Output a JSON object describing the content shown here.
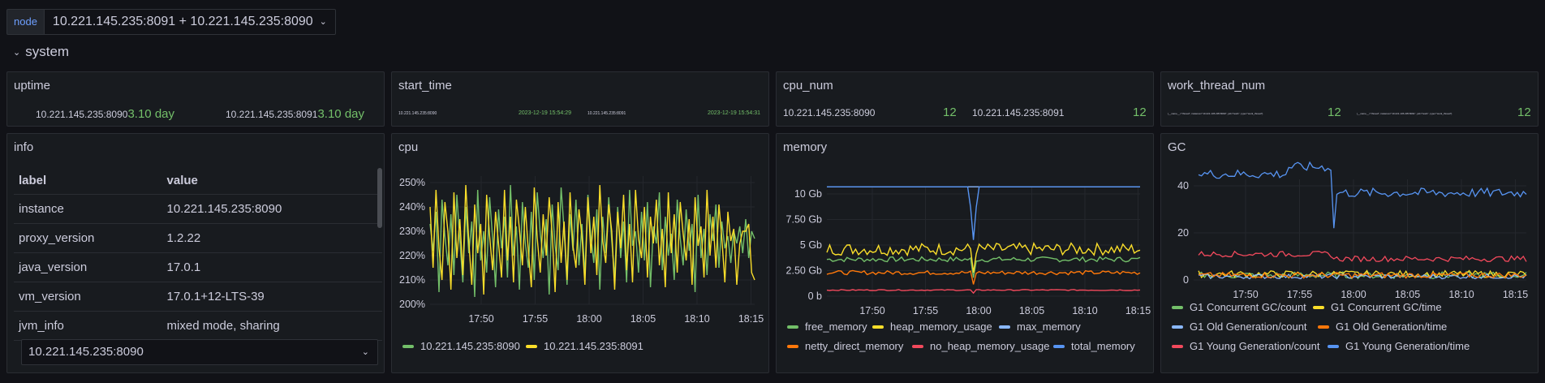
{
  "variable": {
    "label": "node",
    "value": "10.221.145.235:8091 + 10.221.145.235:8090"
  },
  "row": {
    "title": "system"
  },
  "colors": {
    "green": "#73bf69",
    "yellow": "#fade2a",
    "blue": "#5794f2",
    "orange": "#ff780a",
    "red": "#f2495c"
  },
  "uptime": {
    "title": "uptime",
    "items": [
      {
        "label": "10.221.145.235:8090",
        "value": "3.10 day"
      },
      {
        "label": "10.221.145.235:8091",
        "value": "3.10 day"
      }
    ]
  },
  "start_time": {
    "title": "start_time",
    "items": [
      {
        "label": "10.221.145.235:8090",
        "value": "2023-12-19 15:54:29"
      },
      {
        "label": "10.221.145.235:8091",
        "value": "2023-12-19 15:54:31"
      }
    ]
  },
  "cpu_num": {
    "title": "cpu_num",
    "items": [
      {
        "label": "10.221.145.235:8090",
        "value": "12"
      },
      {
        "label": "10.221.145.235:8091",
        "value": "12"
      }
    ]
  },
  "work_thread_num": {
    "title": "work_thread_num",
    "items": [
      {
        "label": "{__name__=\"thread\", instance=\"10.221.145.235:8090\", job=\"test1\", type=\"work_thread\"}",
        "value": "12"
      },
      {
        "label": "{__name__=\"thread\", instance=\"10.221.145.235:8091\", job=\"test1\", type=\"work_thread\"}",
        "value": "12"
      }
    ]
  },
  "info": {
    "title": "info",
    "headers": [
      "label",
      "value"
    ],
    "rows": [
      [
        "instance",
        "10.221.145.235:8090"
      ],
      [
        "proxy_version",
        "1.2.22"
      ],
      [
        "java_version",
        "17.0.1"
      ],
      [
        "vm_version",
        "17.0.1+12-LTS-39"
      ],
      [
        "jvm_info",
        "mixed mode, sharing"
      ]
    ],
    "selected": "10.221.145.235:8090"
  },
  "cpu": {
    "title": "cpu",
    "legend": [
      "10.221.145.235:8090",
      "10.221.145.235:8091"
    ]
  },
  "memory": {
    "title": "memory",
    "legend": [
      "free_memory",
      "heap_memory_usage",
      "max_memory",
      "netty_direct_memory",
      "no_heap_memory_usage",
      "total_memory"
    ]
  },
  "gc": {
    "title": "GC",
    "legend": [
      "G1 Concurrent GC/count",
      "G1 Concurrent GC/time",
      "G1 Old Generation/count",
      "G1 Old Generation/time",
      "G1 Young Generation/count",
      "G1 Young Generation/time"
    ]
  },
  "chart_data": [
    {
      "type": "line",
      "title": "cpu",
      "x_ticks": [
        "17:50",
        "17:55",
        "18:00",
        "18:05",
        "18:10",
        "18:15"
      ],
      "y_ticks": [
        "250%",
        "240%",
        "230%",
        "220%",
        "210%",
        "200%"
      ],
      "ylim": [
        200,
        255
      ],
      "series": [
        {
          "name": "10.221.145.235:8090",
          "color": "#73bf69",
          "values": [
            233,
            222,
            238,
            205,
            243,
            228,
            216,
            237,
            212,
            245,
            226,
            209,
            240,
            221,
            234,
            203,
            247,
            218,
            230,
            213,
            244,
            227,
            207,
            239,
            223,
            236,
            211,
            249,
            220,
            232,
            206,
            242,
            225,
            215,
            238,
            210,
            246,
            229,
            219,
            235,
            204,
            241,
            224,
            214,
            248,
            231,
            208,
            237,
            222,
            243,
            216,
            233,
            212,
            245,
            228,
            217,
            239,
            206,
            236,
            221,
            244,
            226,
            211,
            240,
            219,
            234,
            209,
            247,
            224,
            230,
            213,
            238,
            218,
            242,
            207,
            232,
            225,
            246,
            214,
            236,
            220,
            229,
            210,
            243,
            227,
            216,
            239,
            222,
            233,
            205,
            245,
            219,
            231,
            212,
            237,
            226,
            241,
            215,
            234,
            223,
            228,
            217,
            230,
            225,
            232,
            221,
            235,
            219,
            230,
            227
          ]
        },
        {
          "name": "10.221.145.235:8091",
          "color": "#fade2a",
          "values": [
            240,
            215,
            247,
            223,
            210,
            242,
            230,
            206,
            246,
            219,
            235,
            212,
            249,
            226,
            208,
            241,
            221,
            233,
            204,
            245,
            228,
            214,
            238,
            225,
            211,
            247,
            218,
            236,
            209,
            243,
            231,
            216,
            240,
            222,
            207,
            248,
            227,
            213,
            237,
            220,
            244,
            229,
            205,
            242,
            217,
            234,
            210,
            246,
            224,
            215,
            239,
            228,
            208,
            244,
            221,
            236,
            212,
            249,
            226,
            217,
            241,
            230,
            206,
            238,
            223,
            245,
            214,
            233,
            209,
            247,
            227,
            219,
            240,
            211,
            236,
            225,
            243,
            216,
            231,
            207,
            246,
            221,
            237,
            213,
            242,
            229,
            218,
            235,
            208,
            244,
            224,
            232,
            211,
            247,
            220,
            236,
            215,
            241,
            227,
            209,
            238,
            226,
            231,
            208,
            225,
            230,
            230,
            233,
            213,
            210
          ]
        }
      ]
    },
    {
      "type": "line",
      "title": "memory",
      "x_ticks": [
        "17:50",
        "17:55",
        "18:00",
        "18:05",
        "18:10",
        "18:15"
      ],
      "y_ticks": [
        "10 Gb",
        "7.50 Gb",
        "5 Gb",
        "2.50 Gb",
        "0 b"
      ],
      "ylim": [
        0,
        11
      ],
      "series": [
        {
          "name": "free_memory",
          "color": "#73bf69",
          "level": 3.6,
          "noise": 0.25
        },
        {
          "name": "heap_memory_usage",
          "color": "#fade2a",
          "level": 4.6,
          "noise": 0.6
        },
        {
          "name": "max_memory",
          "color": "#8ab8ff",
          "level": 10.7,
          "noise": 0
        },
        {
          "name": "netty_direct_memory",
          "color": "#ff780a",
          "level": 2.3,
          "noise": 0.2
        },
        {
          "name": "no_heap_memory_usage",
          "color": "#f2495c",
          "level": 0.6,
          "noise": 0.05
        },
        {
          "name": "total_memory",
          "color": "#5794f2",
          "level": 10.7,
          "noise": 0,
          "dip": 5.5
        }
      ]
    },
    {
      "type": "line",
      "title": "GC",
      "x_ticks": [
        "17:50",
        "17:55",
        "18:00",
        "18:05",
        "18:10",
        "18:15"
      ],
      "y_ticks": [
        "40",
        "20",
        "0"
      ],
      "ylim": [
        0,
        55
      ],
      "series": [
        {
          "name": "G1 Concurrent GC/count",
          "color": "#73bf69",
          "level": 2,
          "noise": 1.5
        },
        {
          "name": "G1 Concurrent GC/time",
          "color": "#fade2a",
          "level": 2.5,
          "noise": 1.5
        },
        {
          "name": "G1 Old Generation/count",
          "color": "#8ab8ff",
          "level": 1.5,
          "noise": 1
        },
        {
          "name": "G1 Old Generation/time",
          "color": "#ff780a",
          "level": 2,
          "noise": 1.2
        },
        {
          "name": "G1 Young Generation/count",
          "color": "#f2495c",
          "level": 11,
          "noise": 1.2,
          "drop": 9
        },
        {
          "name": "G1 Young Generation/time",
          "color": "#5794f2",
          "level": 45,
          "noise": 2,
          "drop": 37
        }
      ]
    }
  ]
}
